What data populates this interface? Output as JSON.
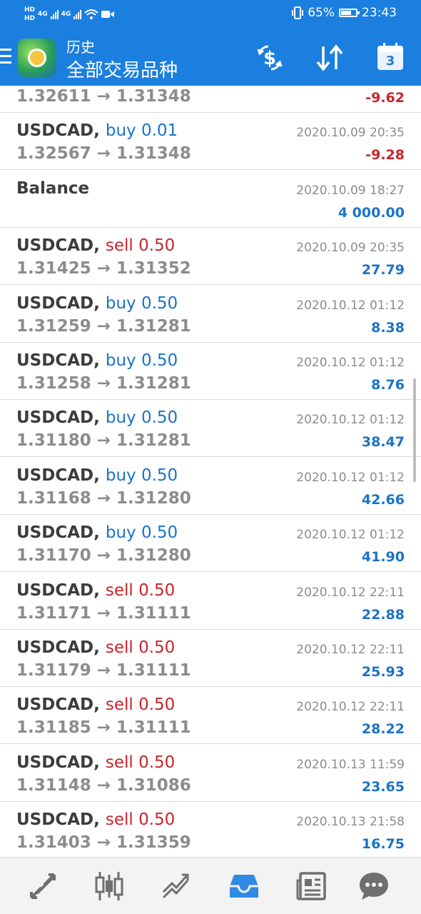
{
  "status_bar": {
    "hd1": "HD",
    "hd2": "HD",
    "sig1": "4G",
    "sig2": "4G",
    "battery": "65%",
    "time": "23:43"
  },
  "header": {
    "subtitle": "历史",
    "title": "全部交易品种",
    "calendar_day": "3"
  },
  "deals": [
    {
      "symbol": "",
      "side": "",
      "side_type": "",
      "prices": "1.32611 → 1.31348",
      "time": "",
      "profit": "-9.62",
      "profit_type": "neg"
    },
    {
      "symbol": "USDCAD,",
      "side": "buy 0.01",
      "side_type": "buy",
      "prices": "1.32567 → 1.31348",
      "time": "2020.10.09 20:35",
      "profit": "-9.28",
      "profit_type": "neg"
    },
    {
      "symbol": "Balance",
      "side": "",
      "side_type": "",
      "prices": "",
      "time": "2020.10.09 18:27",
      "profit": "4 000.00",
      "profit_type": "pos"
    },
    {
      "symbol": "USDCAD,",
      "side": "sell 0.50",
      "side_type": "sell",
      "prices": "1.31425 → 1.31352",
      "time": "2020.10.09 20:35",
      "profit": "27.79",
      "profit_type": "pos"
    },
    {
      "symbol": "USDCAD,",
      "side": "buy 0.50",
      "side_type": "buy",
      "prices": "1.31259 → 1.31281",
      "time": "2020.10.12 01:12",
      "profit": "8.38",
      "profit_type": "pos"
    },
    {
      "symbol": "USDCAD,",
      "side": "buy 0.50",
      "side_type": "buy",
      "prices": "1.31258 → 1.31281",
      "time": "2020.10.12 01:12",
      "profit": "8.76",
      "profit_type": "pos"
    },
    {
      "symbol": "USDCAD,",
      "side": "buy 0.50",
      "side_type": "buy",
      "prices": "1.31180 → 1.31281",
      "time": "2020.10.12 01:12",
      "profit": "38.47",
      "profit_type": "pos"
    },
    {
      "symbol": "USDCAD,",
      "side": "buy 0.50",
      "side_type": "buy",
      "prices": "1.31168 → 1.31280",
      "time": "2020.10.12 01:12",
      "profit": "42.66",
      "profit_type": "pos"
    },
    {
      "symbol": "USDCAD,",
      "side": "buy 0.50",
      "side_type": "buy",
      "prices": "1.31170 → 1.31280",
      "time": "2020.10.12 01:12",
      "profit": "41.90",
      "profit_type": "pos"
    },
    {
      "symbol": "USDCAD,",
      "side": "sell 0.50",
      "side_type": "sell",
      "prices": "1.31171 → 1.31111",
      "time": "2020.10.12 22:11",
      "profit": "22.88",
      "profit_type": "pos"
    },
    {
      "symbol": "USDCAD,",
      "side": "sell 0.50",
      "side_type": "sell",
      "prices": "1.31179 → 1.31111",
      "time": "2020.10.12 22:11",
      "profit": "25.93",
      "profit_type": "pos"
    },
    {
      "symbol": "USDCAD,",
      "side": "sell 0.50",
      "side_type": "sell",
      "prices": "1.31185 → 1.31111",
      "time": "2020.10.12 22:11",
      "profit": "28.22",
      "profit_type": "pos"
    },
    {
      "symbol": "USDCAD,",
      "side": "sell 0.50",
      "side_type": "sell",
      "prices": "1.31148 → 1.31086",
      "time": "2020.10.13 11:59",
      "profit": "23.65",
      "profit_type": "pos"
    },
    {
      "symbol": "USDCAD,",
      "side": "sell 0.50",
      "side_type": "sell",
      "prices": "1.31403 → 1.31359",
      "time": "2020.10.13 21:58",
      "profit": "16.75",
      "profit_type": "pos"
    }
  ],
  "bottom_nav": [
    {
      "name": "nav-quotes",
      "icon": "quotes-arrows-icon"
    },
    {
      "name": "nav-chart",
      "icon": "candlestick-icon"
    },
    {
      "name": "nav-trade",
      "icon": "trend-icon"
    },
    {
      "name": "nav-history",
      "icon": "inbox-icon",
      "active": true
    },
    {
      "name": "nav-news",
      "icon": "newspaper-icon"
    },
    {
      "name": "nav-messages",
      "icon": "chat-icon"
    }
  ],
  "colors": {
    "header_bg": "#1b7fe0",
    "buy": "#1a73c7",
    "sell": "#c8252b",
    "active_nav": "#2f8ae5",
    "inactive_nav": "#6f6f6f"
  }
}
